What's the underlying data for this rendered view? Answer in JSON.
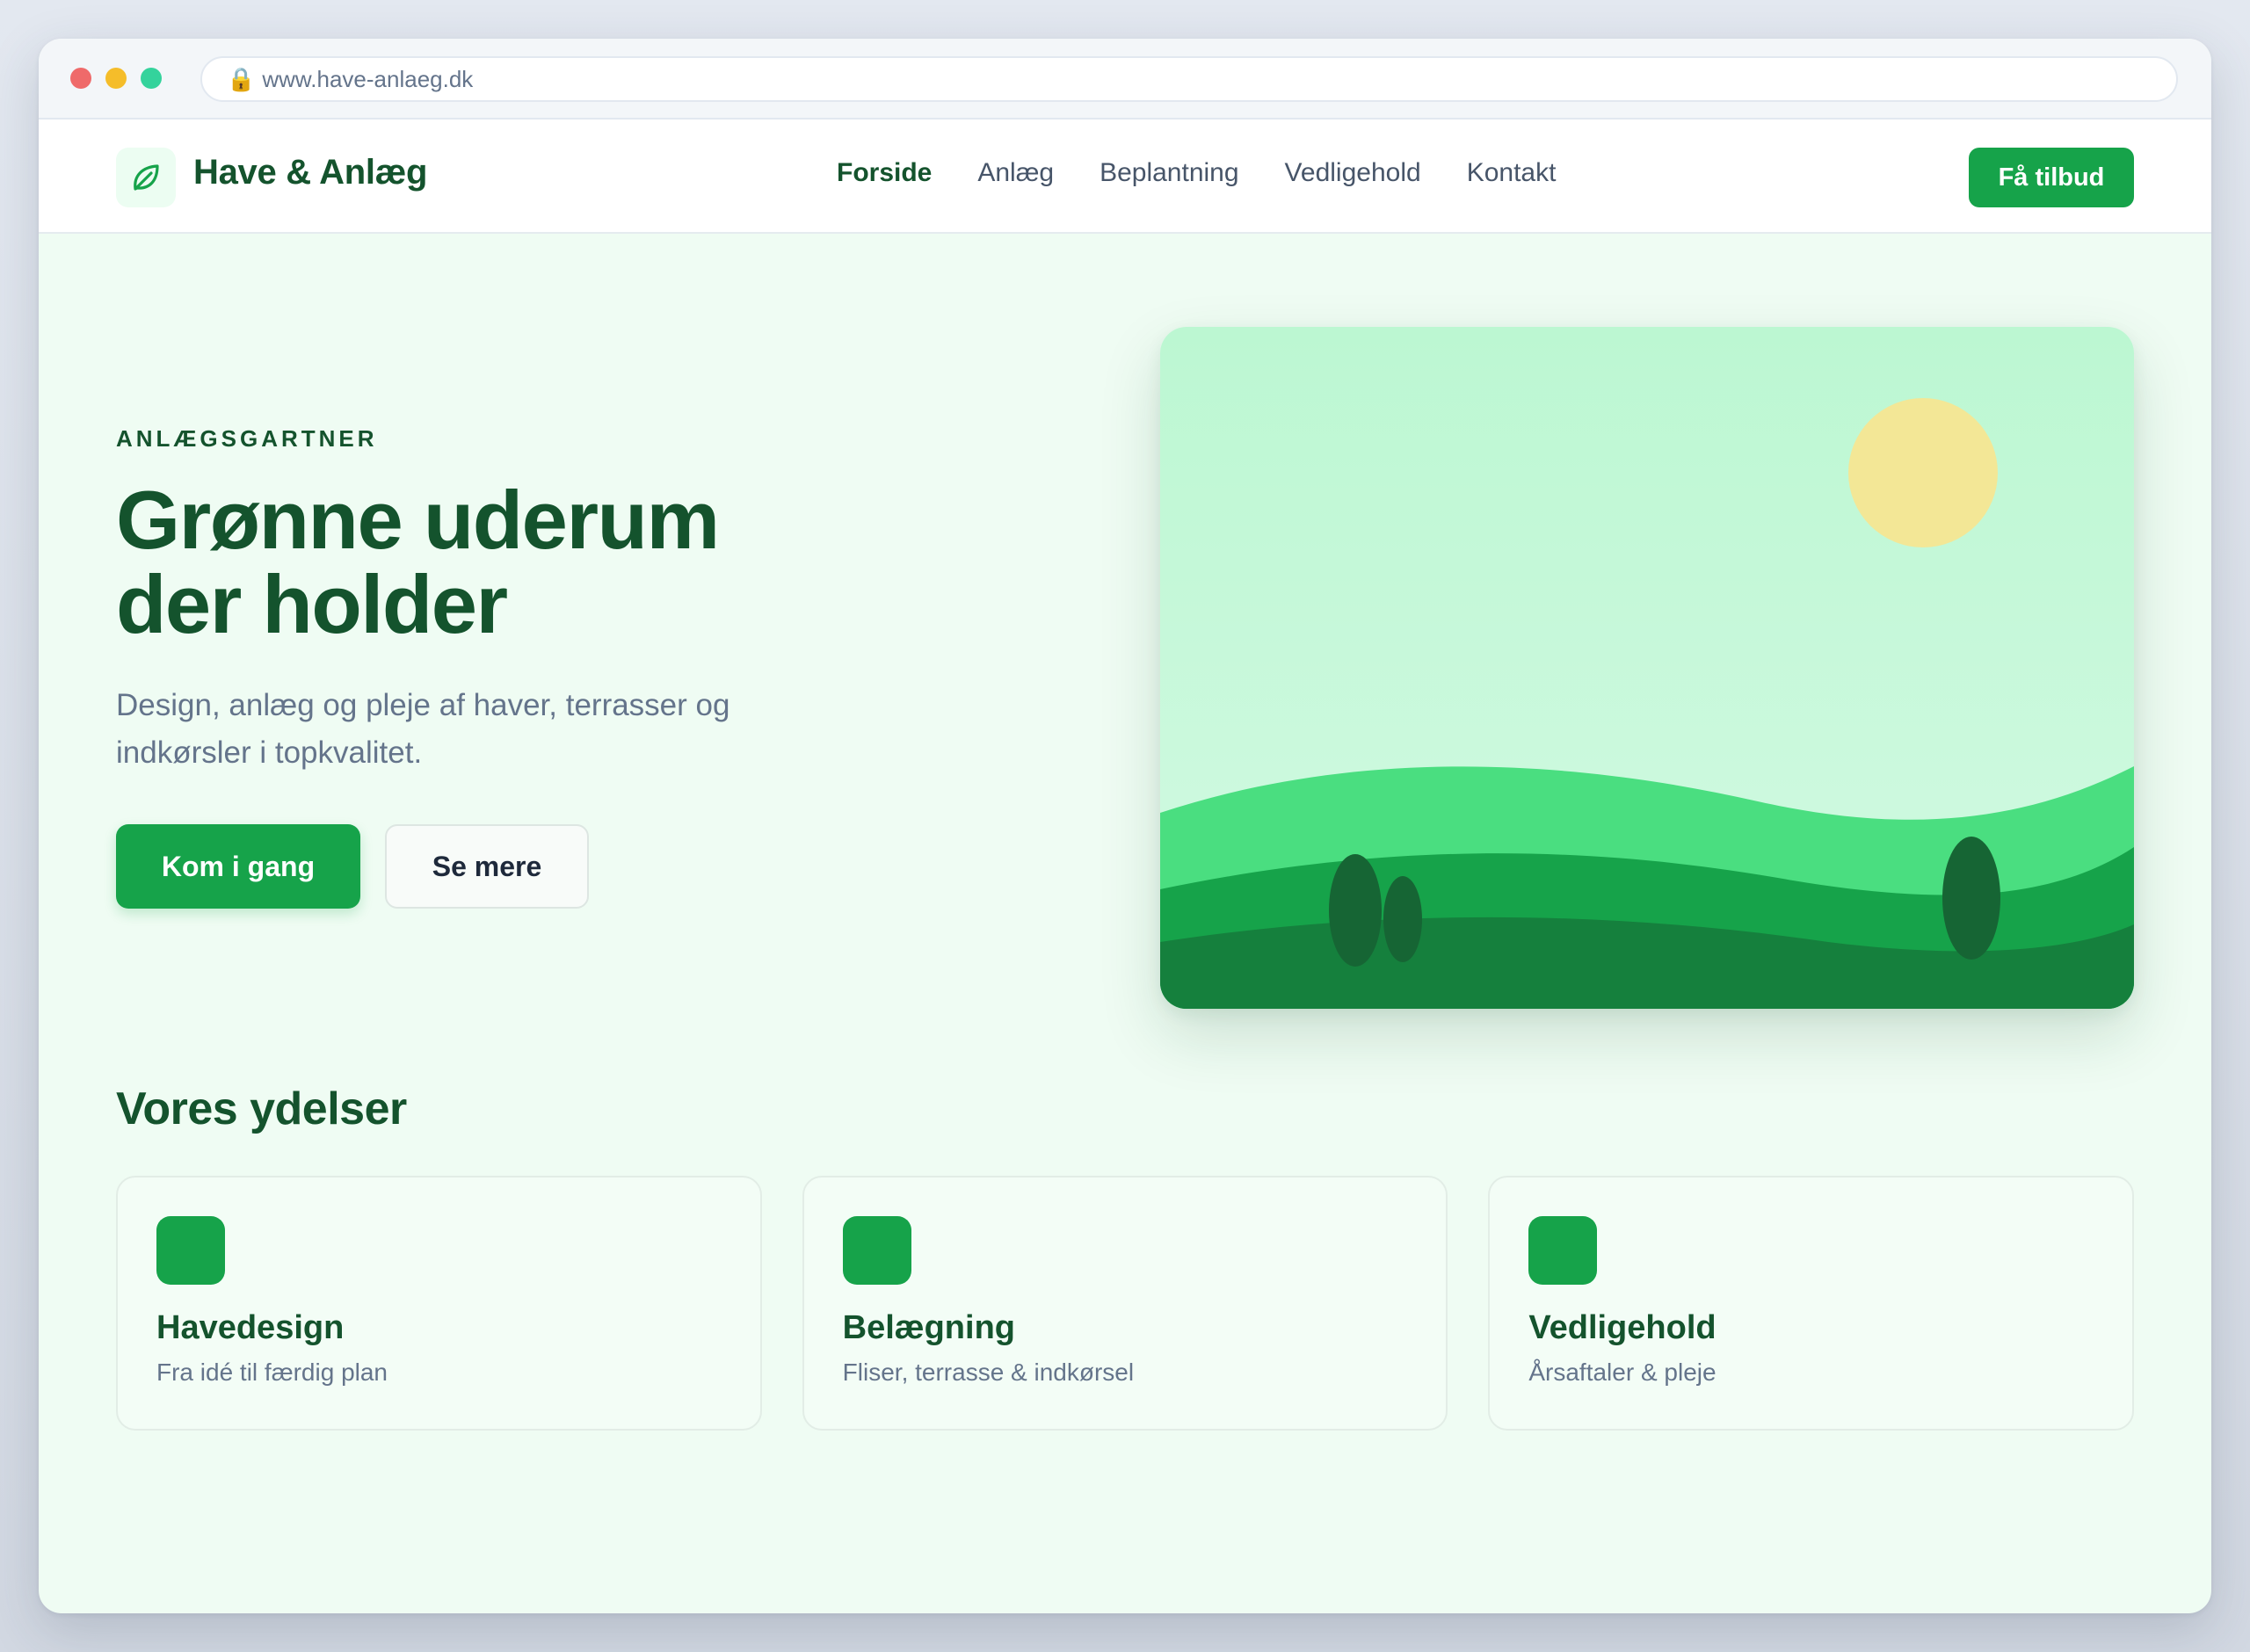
{
  "browser": {
    "url": "www.have-anlaeg.dk"
  },
  "nav": {
    "brand": "Have & Anlæg",
    "links": [
      "Forside",
      "Anlæg",
      "Beplantning",
      "Vedligehold",
      "Kontakt"
    ],
    "active_link": "Forside",
    "cta": "Få tilbud"
  },
  "hero": {
    "eyebrow": "ANLÆGSGARTNER",
    "title_line1": "Grønne uderum",
    "title_line2": "der holder",
    "subtitle_line1": "Design, anlæg og pleje af haver, terrasser og",
    "subtitle_line2": "indkørsler i topkvalitet.",
    "primary_button": "Kom i gang",
    "secondary_button": "Se mere"
  },
  "services": {
    "title": "Vores ydelser",
    "items": [
      {
        "title": "Havedesign",
        "desc": "Fra idé til færdig plan"
      },
      {
        "title": "Belægning",
        "desc": "Fliser, terrasse & indkørsel"
      },
      {
        "title": "Vedligehold",
        "desc": "Årsaftaler & pleje"
      }
    ]
  },
  "colors": {
    "brand_green": "#16a34a",
    "dark_green": "#14532d",
    "page_bg": "#effcf3",
    "sun": "#f3e796"
  },
  "icons": {
    "logo": "leaf-icon",
    "url_lock": "lock-icon"
  }
}
